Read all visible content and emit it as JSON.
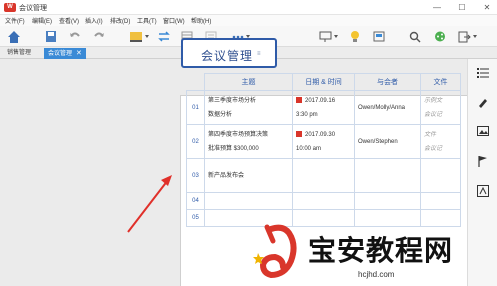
{
  "app": {
    "logo": "W",
    "title": "会议管理"
  },
  "menu": [
    "文件(F)",
    "编辑(E)",
    "查看(V)",
    "插入(I)",
    "排改(D)",
    "工具(T)",
    "窗口(W)",
    "帮助(H)"
  ],
  "tabs": [
    {
      "label": "销售管理"
    },
    {
      "label": "会议管理",
      "close": "✕"
    }
  ],
  "document": {
    "title": "会议管理",
    "badge": "≡",
    "headers": [
      "主题",
      "日期 & 时间",
      "与会者",
      "文件"
    ],
    "rows": [
      {
        "num": "01",
        "topic1": "第三季度市场分析",
        "topic2": "数据分析",
        "date": "2017.09.16",
        "time": "3:30 pm",
        "attendees": "Owen/Molly/Anna",
        "file1": "示例文",
        "file2": "会议记"
      },
      {
        "num": "02",
        "topic1": "第四季度市场预算决策",
        "topic2": "批准预算 $300,000",
        "date": "2017.09.30",
        "time": "10:00 am",
        "attendees": "Owen/Stephen",
        "file1": "文件",
        "file2": "会议记"
      },
      {
        "num": "03",
        "topic1": "新产品发布会",
        "topic2": "",
        "date": "",
        "time": "",
        "attendees": "",
        "file1": "",
        "file2": ""
      },
      {
        "num": "04"
      },
      {
        "num": "05"
      }
    ]
  },
  "watermark": {
    "text": "宝安教程网",
    "url": "hcjhd.com"
  },
  "colors": {
    "accent": "#3a8ad6",
    "title_border": "#2f5ba8",
    "arrow": "#e0302a",
    "brand_red": "#d9362b"
  }
}
